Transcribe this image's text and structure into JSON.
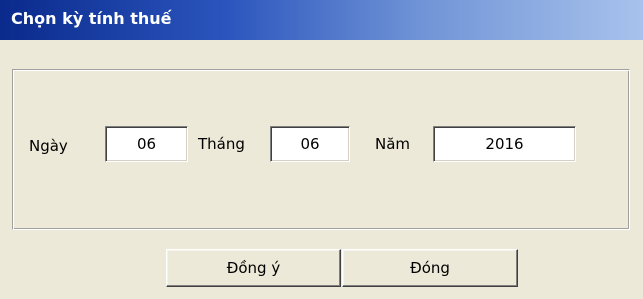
{
  "window": {
    "title": "Chọn kỳ tính thuế"
  },
  "form": {
    "day_label": "Ngày",
    "day_value": "06",
    "month_label": "Tháng",
    "month_value": "06",
    "year_label": "Năm",
    "year_value": "2016"
  },
  "buttons": {
    "ok_label": "Đồng ý",
    "close_label": "Đóng"
  },
  "colors": {
    "title_bar_start": "#0a2a8c",
    "title_bar_end": "#a8c2ec",
    "dialog_background": "#ece9d8"
  }
}
